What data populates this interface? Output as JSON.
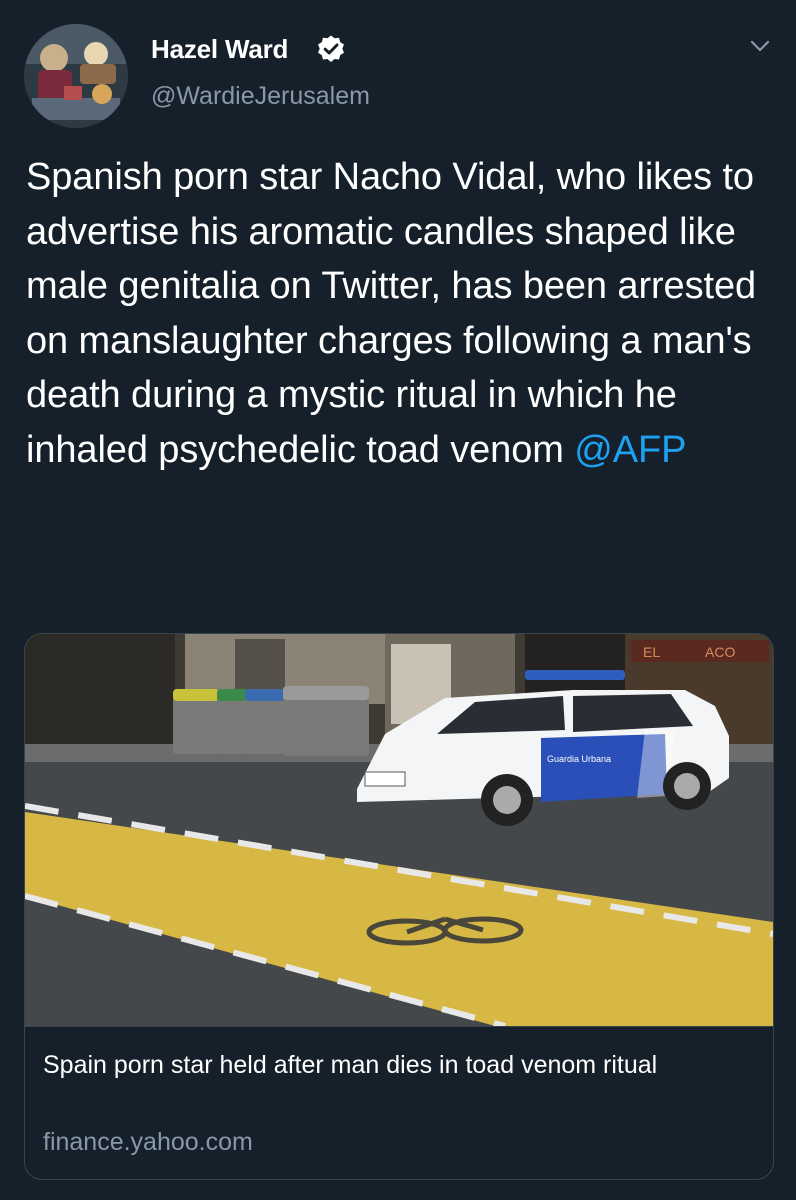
{
  "author": {
    "name": "Hazel Ward",
    "handle": "@WardieJerusalem",
    "verified": true
  },
  "icons": {
    "verified": "verified-badge-icon",
    "more": "chevron-down-icon"
  },
  "tweet": {
    "text": "Spanish porn star Nacho Vidal, who likes to advertise his aromatic candles shaped like male genitalia on Twitter, has been arrested on manslaughter charges following a man's death during a mystic ritual in which he inhaled psychedelic toad venom",
    "mention": "@AFP"
  },
  "card": {
    "image_signs": {
      "shop_left": "EL",
      "shop_right": "ACO"
    },
    "car_label": "Guardia Urbana",
    "title": "Spain porn star held after man dies in toad venom ritual",
    "domain": "finance.yahoo.com"
  },
  "colors": {
    "background": "#15202b",
    "text": "#ffffff",
    "secondary_text": "#8899a6",
    "link": "#1da1f2",
    "border": "#38444d"
  }
}
